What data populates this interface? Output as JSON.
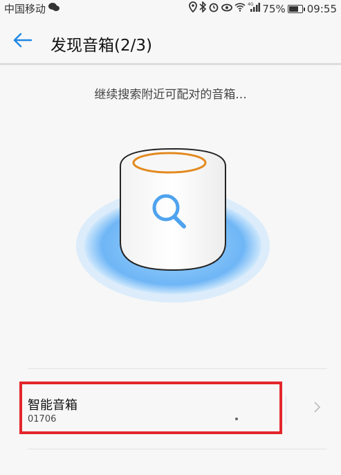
{
  "status_bar": {
    "carrier": "中国移动",
    "battery": "75%",
    "battery_level": 0.75,
    "time": "09:55",
    "network": "4G"
  },
  "header": {
    "title": "发现音箱(2/3)",
    "back_icon": "arrow-left-icon"
  },
  "main": {
    "searching_text": "继续搜索附近可配对的音箱..."
  },
  "device_list": [
    {
      "name": "智能音箱",
      "id": "01706"
    }
  ],
  "colors": {
    "accent_blue": "#1e88e5",
    "highlight_red": "#e3262b",
    "speaker_ring": "#e38a1f"
  }
}
